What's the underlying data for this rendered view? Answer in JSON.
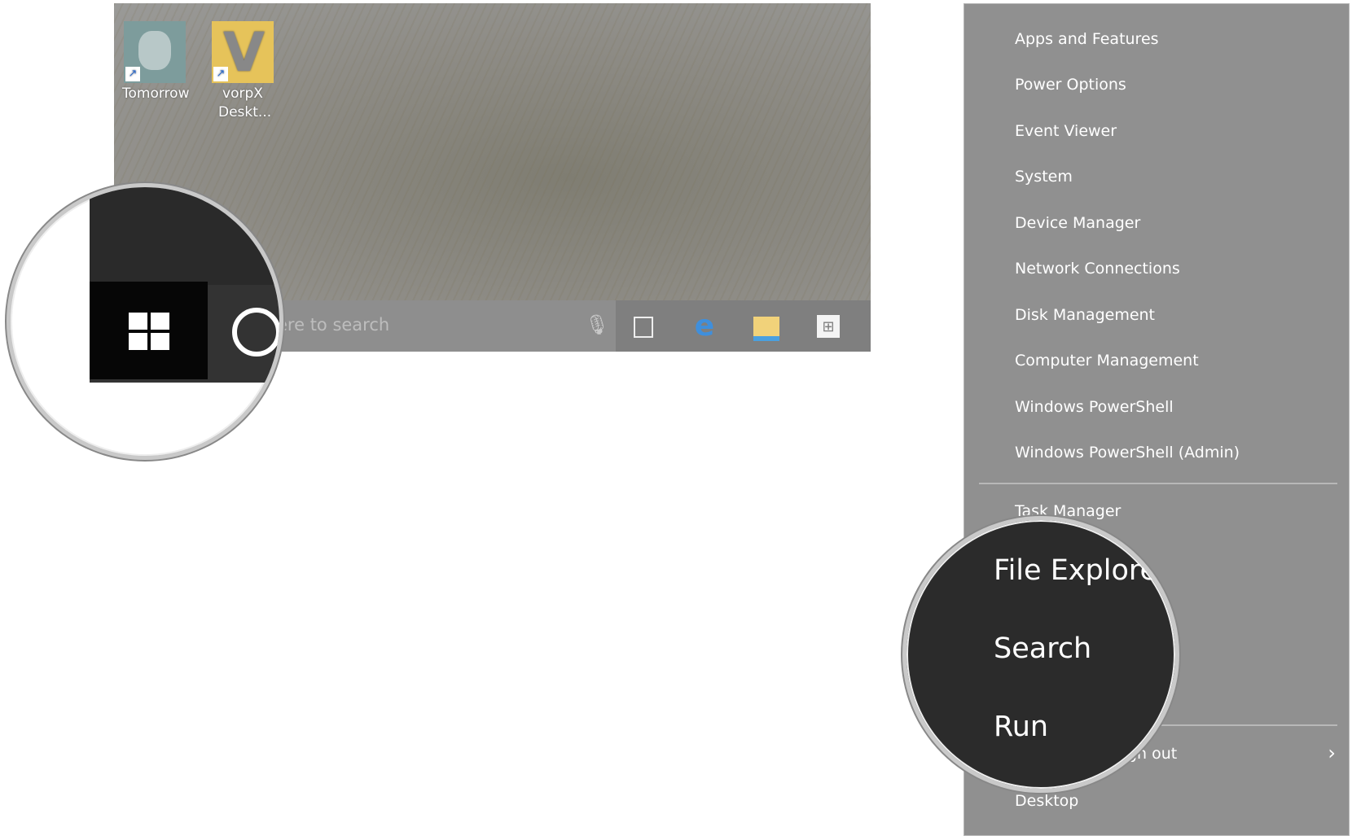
{
  "desktop": {
    "icons": [
      {
        "label": "Tomorrow"
      },
      {
        "label": "vorpX Deskt..."
      }
    ]
  },
  "taskbar": {
    "search_placeholder": "ere to search",
    "icons": [
      "microphone-icon",
      "task-view-icon",
      "edge-icon",
      "file-explorer-icon",
      "store-icon"
    ]
  },
  "magnifier_start": {
    "icons": [
      "windows-start-icon",
      "cortana-icon"
    ]
  },
  "menu": {
    "items": [
      {
        "label": "Apps and Features"
      },
      {
        "label": "Power Options"
      },
      {
        "label": "Event Viewer"
      },
      {
        "label": "System"
      },
      {
        "label": "Device Manager"
      },
      {
        "label": "Network Connections"
      },
      {
        "label": "Disk Management"
      },
      {
        "label": "Computer Management"
      },
      {
        "label": "Windows PowerShell"
      },
      {
        "label": "Windows PowerShell (Admin)"
      }
    ],
    "group2": [
      {
        "label": "Task Manager"
      }
    ],
    "shutdown_partial": "gn out",
    "desktop": "Desktop"
  },
  "magnifier_menu": {
    "items": [
      {
        "label": "File Explorer"
      },
      {
        "label": "Search"
      },
      {
        "label": "Run"
      }
    ]
  },
  "colors": {
    "menu_bg": "#909090",
    "magnifier_bg": "#2b2b2b",
    "edge": "#3f8fdc"
  }
}
